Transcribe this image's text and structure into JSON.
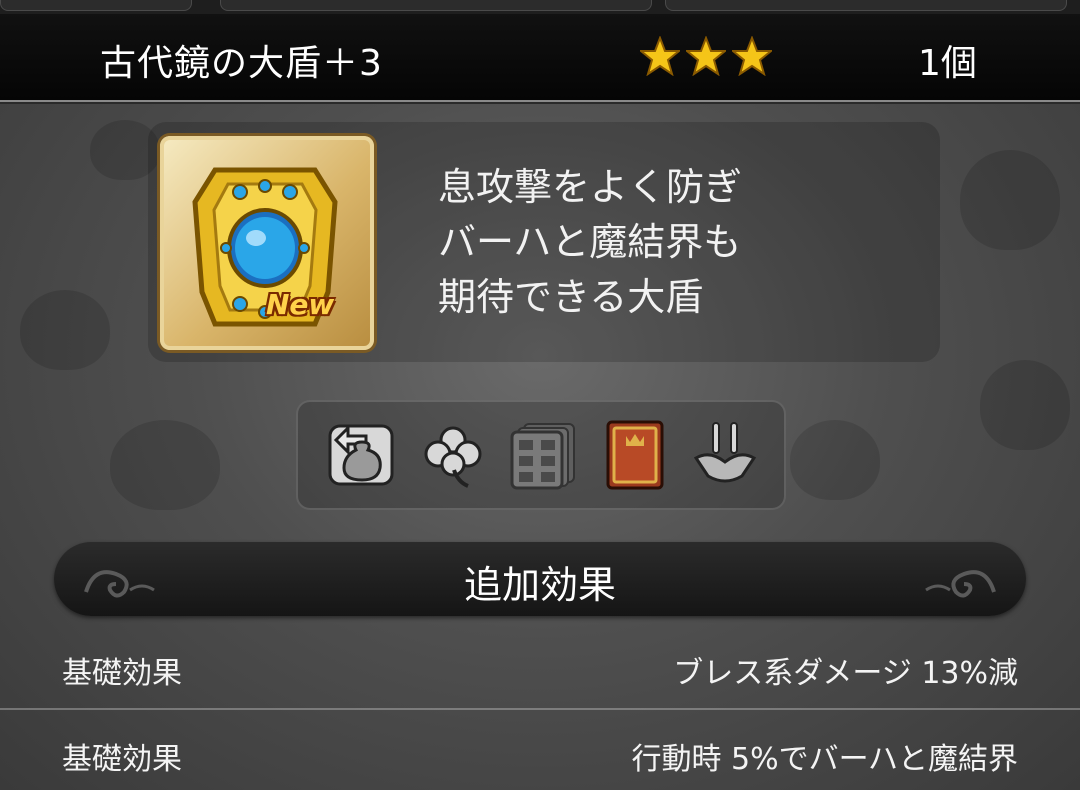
{
  "item": {
    "name": "古代鏡の大盾＋3",
    "star_count": 3,
    "quantity": "1個",
    "new_badge": "New",
    "description": [
      "息攻撃をよく防ぎ",
      "バーハと魔結界も",
      "期待できる大盾"
    ]
  },
  "equip_icons": [
    "pouch-return-icon",
    "clover-icon",
    "storage-drawer-icon",
    "red-book-icon",
    "hanger-icon"
  ],
  "effects": {
    "title": "追加効果",
    "rows": [
      {
        "label": "基礎効果",
        "value": "ブレス系ダメージ 13%減"
      },
      {
        "label": "基礎効果",
        "value": "行動時 5%でバーハと魔結界"
      }
    ]
  },
  "colors": {
    "star": "#f5c518",
    "accent_gold": "#d9b56a",
    "gem_blue": "#2aa6e8",
    "badge": "#ffd24a"
  }
}
